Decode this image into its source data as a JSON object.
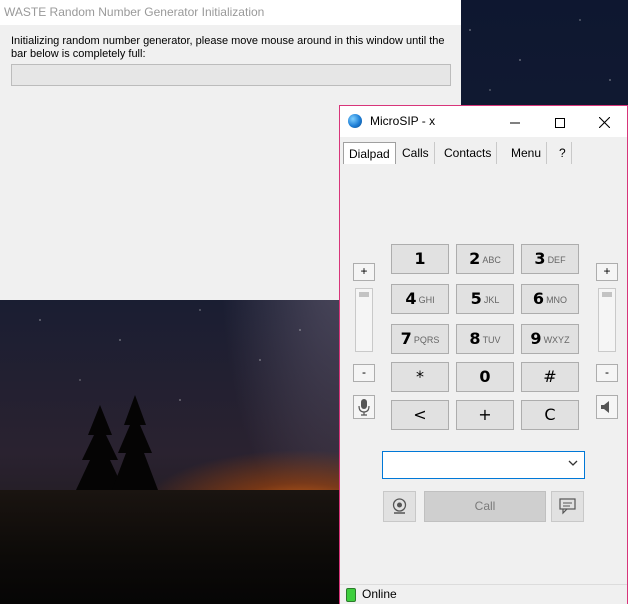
{
  "waste": {
    "title": "WASTE Random Number Generator Initialization",
    "message": "Initializing random number generator, please move mouse around in this window until the bar below is completely full:",
    "progress": 0
  },
  "microsip": {
    "title": "MicroSIP - x",
    "tabs": [
      "Dialpad",
      "Calls",
      "Contacts",
      "Menu",
      "?"
    ],
    "active_tab": "Dialpad",
    "keys": [
      {
        "main": "1",
        "sub": ""
      },
      {
        "main": "2",
        "sub": "ABC"
      },
      {
        "main": "3",
        "sub": "DEF"
      },
      {
        "main": "4",
        "sub": "GHI"
      },
      {
        "main": "5",
        "sub": "JKL"
      },
      {
        "main": "6",
        "sub": "MNO"
      },
      {
        "main": "7",
        "sub": "PQRS"
      },
      {
        "main": "8",
        "sub": "TUV"
      },
      {
        "main": "9",
        "sub": "WXYZ"
      },
      {
        "main": "*",
        "sub": ""
      },
      {
        "main": "0",
        "sub": ""
      },
      {
        "main": "#",
        "sub": ""
      },
      {
        "main": "<",
        "sub": ""
      },
      {
        "main": "+",
        "sub": ""
      },
      {
        "main": "C",
        "sub": ""
      }
    ],
    "volume_plus": "+",
    "volume_minus": "-",
    "number_input_value": "",
    "call_label": "Call",
    "status": "Online",
    "icons": {
      "mic": "microphone-icon",
      "speaker": "speaker-icon",
      "video": "video-call-icon",
      "message": "message-icon",
      "dropdown": "chevron-down-icon"
    },
    "colors": {
      "window_border": "#d8357a",
      "combo_border": "#0078d7",
      "status_green": "#3ecf3e"
    }
  }
}
